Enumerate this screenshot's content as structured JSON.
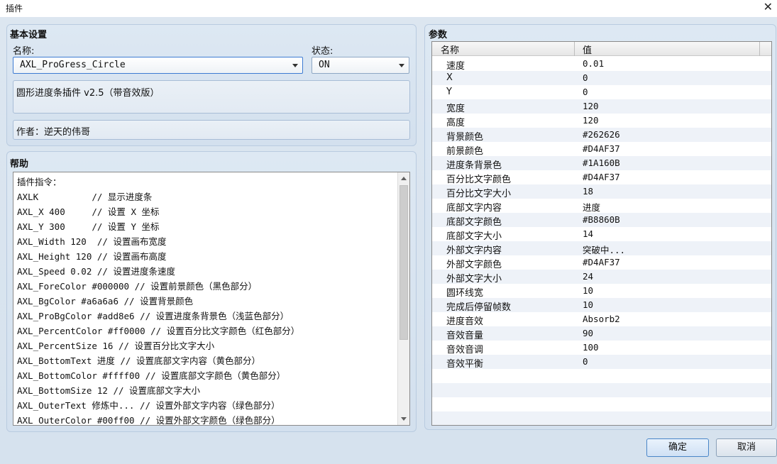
{
  "window": {
    "title": "插件"
  },
  "basic": {
    "title": "基本设置",
    "name_label": "名称:",
    "name_value": "AXL_ProGress_Circle",
    "status_label": "状态:",
    "status_value": "ON",
    "description": "圆形进度条插件 v2.5（带音效版）",
    "author": "作者：逆天的伟哥"
  },
  "help": {
    "title": "帮助",
    "lines": [
      "插件指令：",
      "AXLK          // 显示进度条",
      "AXL_X 400     // 设置 X 坐标",
      "AXL_Y 300     // 设置 Y 坐标",
      "AXL_Width 120  // 设置画布宽度",
      "AXL_Height 120 // 设置画布高度",
      "AXL_Speed 0.02 // 设置进度条速度",
      "AXL_ForeColor #000000 // 设置前景颜色（黑色部分）",
      "AXL_BgColor #a6a6a6 // 设置背景颜色",
      "AXL_ProBgColor #add8e6 // 设置进度条背景色（浅蓝色部分）",
      "AXL_PercentColor #ff0000 // 设置百分比文字颜色（红色部分）",
      "AXL_PercentSize 16 // 设置百分比文字大小",
      "AXL_BottomText 进度 // 设置底部文字内容（黄色部分）",
      "AXL_BottomColor #ffff00 // 设置底部文字颜色（黄色部分）",
      "AXL_BottomSize 12 // 设置底部文字大小",
      "AXL_OuterText 修炼中... // 设置外部文字内容（绿色部分）",
      "AXL_OuterColor #00ff00 // 设置外部文字颜色（绿色部分）"
    ]
  },
  "params": {
    "title": "参数",
    "header_name": "名称",
    "header_value": "值",
    "rows": [
      {
        "name": "速度",
        "value": "0.01"
      },
      {
        "name": "X",
        "value": "0"
      },
      {
        "name": "Y",
        "value": "0"
      },
      {
        "name": "宽度",
        "value": "120"
      },
      {
        "name": "高度",
        "value": "120"
      },
      {
        "name": "背景颜色",
        "value": "#262626"
      },
      {
        "name": "前景颜色",
        "value": "#D4AF37"
      },
      {
        "name": "进度条背景色",
        "value": "#1A160B"
      },
      {
        "name": "百分比文字颜色",
        "value": "#D4AF37"
      },
      {
        "name": "百分比文字大小",
        "value": "18"
      },
      {
        "name": "底部文字内容",
        "value": "进度"
      },
      {
        "name": "底部文字颜色",
        "value": "#B8860B"
      },
      {
        "name": "底部文字大小",
        "value": "14"
      },
      {
        "name": "外部文字内容",
        "value": "突破中..."
      },
      {
        "name": "外部文字颜色",
        "value": "#D4AF37"
      },
      {
        "name": "外部文字大小",
        "value": "24"
      },
      {
        "name": "圆环线宽",
        "value": "10"
      },
      {
        "name": "完成后停留帧数",
        "value": "10"
      },
      {
        "name": "进度音效",
        "value": "Absorb2"
      },
      {
        "name": "音效音量",
        "value": "90"
      },
      {
        "name": "音效音调",
        "value": "100"
      },
      {
        "name": "音效平衡",
        "value": "0"
      }
    ]
  },
  "buttons": {
    "ok": "确定",
    "cancel": "取消"
  },
  "icons": {
    "close": "close-icon",
    "dropdown": "chevron-down-icon",
    "scroll_up": "arrow-up-icon",
    "scroll_down": "arrow-down-icon"
  }
}
